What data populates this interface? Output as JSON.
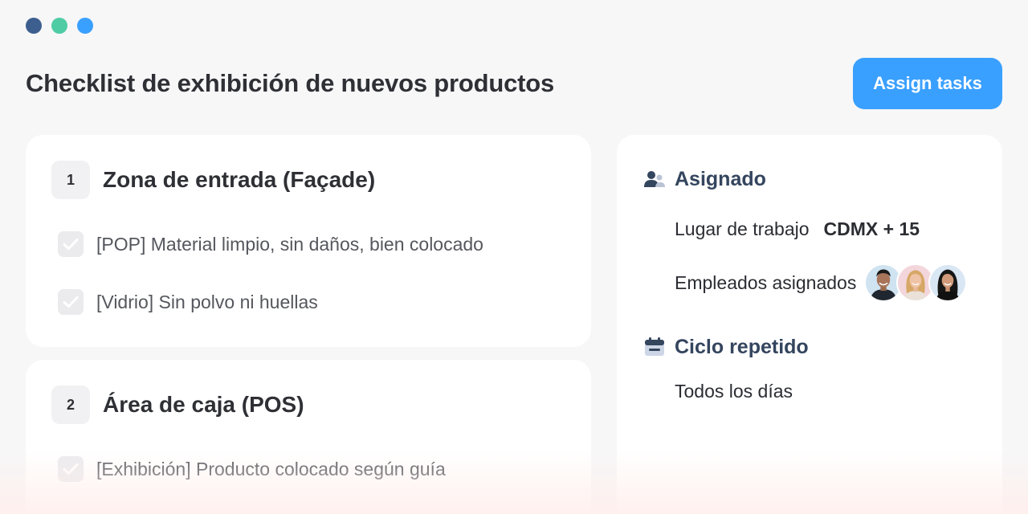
{
  "window": {
    "dots": [
      {
        "name": "dot-1",
        "color": "#3d5f8f"
      },
      {
        "name": "dot-2",
        "color": "#4fcca4"
      },
      {
        "name": "dot-3",
        "color": "#3aa0ff"
      }
    ]
  },
  "header": {
    "title": "Checklist de exhibición de nuevos productos",
    "assign_button": "Assign tasks"
  },
  "sections": [
    {
      "number": "1",
      "title": "Zona de entrada (Façade)",
      "items": [
        "[POP] Material limpio, sin daños, bien colocado",
        "[Vidrio] Sin polvo ni huellas"
      ]
    },
    {
      "number": "2",
      "title": "Área de caja (POS)",
      "items": [
        "[Exhibición] Producto colocado según guía"
      ]
    }
  ],
  "sidebar": {
    "assigned": {
      "icon": "users-icon",
      "title": "Asignado",
      "workplace_label": "Lugar de trabajo",
      "workplace_value": "CDMX + 15",
      "employees_label": "Empleados asignados",
      "avatars": [
        "avatar-man",
        "avatar-woman-blonde",
        "avatar-woman-dark"
      ]
    },
    "cycle": {
      "icon": "calendar-icon",
      "title": "Ciclo repetido",
      "value": "Todos los días"
    }
  },
  "colors": {
    "accent": "#3aa0ff",
    "section_heading": "#34455e",
    "background": "#f7f7f8"
  }
}
